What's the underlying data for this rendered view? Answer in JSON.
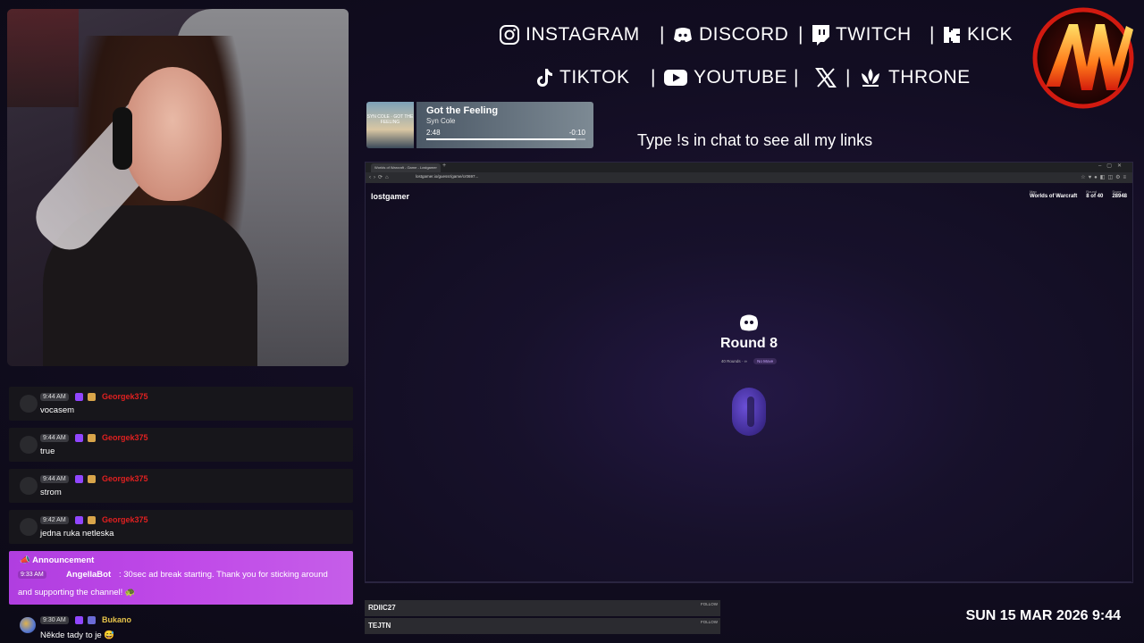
{
  "socials": {
    "instagram": "INSTAGRAM",
    "discord": "DISCORD",
    "twitch": "TWITCH",
    "kick": "KICK",
    "tiktok": "TIKTOK",
    "youtube": "YOUTUBE",
    "throne": "THRONE"
  },
  "links_message": "Type !s in chat to see all my links",
  "now_playing": {
    "art_text": "SYN COLE · GOT THE FEELING",
    "title": "Got the Feeling",
    "artist": "Syn Cole",
    "elapsed": "2:48",
    "remaining": "-0:10",
    "progress": 0.94
  },
  "browser": {
    "tab_title": "Worlds of Warcraft - Game - Lostgamer",
    "url": "lostgamer.io/guessr/game/cr0697...",
    "site_logo": "lostgamer",
    "stats": [
      {
        "label": "Map",
        "value": "Worlds of Warcraft"
      },
      {
        "label": "Round",
        "value": "8 of 40"
      },
      {
        "label": "Score",
        "value": "28948"
      }
    ],
    "round_title": "Round 8",
    "round_meta": "40 Rounds · ∞",
    "round_pill": "No Move"
  },
  "followers": [
    {
      "name": "RDIIC27",
      "tag": "FOLLOW"
    },
    {
      "name": "TEJTN",
      "tag": "FOLLOW"
    }
  ],
  "datetime": "SUN 15 MAR 2026 9:44",
  "chat": [
    {
      "time": "9:44 AM",
      "user": "Georgek375",
      "text": "vocasem",
      "color": "#e02020"
    },
    {
      "time": "9:44 AM",
      "user": "Georgek375",
      "text": "true",
      "color": "#e02020"
    },
    {
      "time": "9:44 AM",
      "user": "Georgek375",
      "text": "strom",
      "color": "#e02020"
    },
    {
      "time": "9:42 AM",
      "user": "Georgek375",
      "text": "jedna ruka netleska",
      "color": "#e02020"
    }
  ],
  "announcement": {
    "heading": "Announcement",
    "time": "9:33 AM",
    "user": "AngellaBot",
    "line1": ": 30sec ad break starting. Thank you for sticking around",
    "line2": "and supporting the channel! 🐢"
  },
  "last_chat": {
    "time": "9:30 AM",
    "user": "Bukano",
    "text": "Někde tady to je 😅"
  },
  "colors": {
    "accent_purple": "#b03ee0",
    "username_red": "#e02020",
    "username_gold": "#e6c34a"
  }
}
